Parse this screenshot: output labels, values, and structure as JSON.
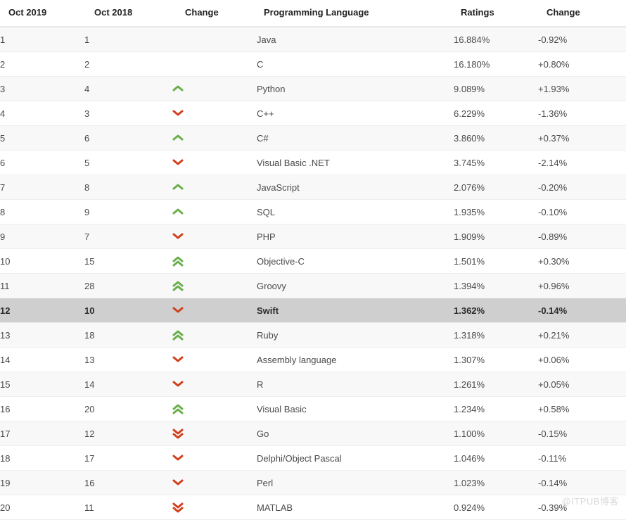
{
  "table": {
    "headers": {
      "rank_now": "Oct 2019",
      "rank_prev": "Oct 2018",
      "change_dir": "Change",
      "language": "Programming Language",
      "ratings": "Ratings",
      "change_val": "Change"
    },
    "rows": [
      {
        "rank_now": "1",
        "rank_prev": "1",
        "change_dir": "none",
        "language": "Java",
        "ratings": "16.884%",
        "change_val": "-0.92%",
        "highlight": false
      },
      {
        "rank_now": "2",
        "rank_prev": "2",
        "change_dir": "none",
        "language": "C",
        "ratings": "16.180%",
        "change_val": "+0.80%",
        "highlight": false
      },
      {
        "rank_now": "3",
        "rank_prev": "4",
        "change_dir": "up",
        "language": "Python",
        "ratings": "9.089%",
        "change_val": "+1.93%",
        "highlight": false
      },
      {
        "rank_now": "4",
        "rank_prev": "3",
        "change_dir": "down",
        "language": "C++",
        "ratings": "6.229%",
        "change_val": "-1.36%",
        "highlight": false
      },
      {
        "rank_now": "5",
        "rank_prev": "6",
        "change_dir": "up",
        "language": "C#",
        "ratings": "3.860%",
        "change_val": "+0.37%",
        "highlight": false
      },
      {
        "rank_now": "6",
        "rank_prev": "5",
        "change_dir": "down",
        "language": "Visual Basic .NET",
        "ratings": "3.745%",
        "change_val": "-2.14%",
        "highlight": false
      },
      {
        "rank_now": "7",
        "rank_prev": "8",
        "change_dir": "up",
        "language": "JavaScript",
        "ratings": "2.076%",
        "change_val": "-0.20%",
        "highlight": false
      },
      {
        "rank_now": "8",
        "rank_prev": "9",
        "change_dir": "up",
        "language": "SQL",
        "ratings": "1.935%",
        "change_val": "-0.10%",
        "highlight": false
      },
      {
        "rank_now": "9",
        "rank_prev": "7",
        "change_dir": "down",
        "language": "PHP",
        "ratings": "1.909%",
        "change_val": "-0.89%",
        "highlight": false
      },
      {
        "rank_now": "10",
        "rank_prev": "15",
        "change_dir": "up-double",
        "language": "Objective-C",
        "ratings": "1.501%",
        "change_val": "+0.30%",
        "highlight": false
      },
      {
        "rank_now": "11",
        "rank_prev": "28",
        "change_dir": "up-double",
        "language": "Groovy",
        "ratings": "1.394%",
        "change_val": "+0.96%",
        "highlight": false
      },
      {
        "rank_now": "12",
        "rank_prev": "10",
        "change_dir": "down",
        "language": "Swift",
        "ratings": "1.362%",
        "change_val": "-0.14%",
        "highlight": true
      },
      {
        "rank_now": "13",
        "rank_prev": "18",
        "change_dir": "up-double",
        "language": "Ruby",
        "ratings": "1.318%",
        "change_val": "+0.21%",
        "highlight": false
      },
      {
        "rank_now": "14",
        "rank_prev": "13",
        "change_dir": "down",
        "language": "Assembly language",
        "ratings": "1.307%",
        "change_val": "+0.06%",
        "highlight": false
      },
      {
        "rank_now": "15",
        "rank_prev": "14",
        "change_dir": "down",
        "language": "R",
        "ratings": "1.261%",
        "change_val": "+0.05%",
        "highlight": false
      },
      {
        "rank_now": "16",
        "rank_prev": "20",
        "change_dir": "up-double",
        "language": "Visual Basic",
        "ratings": "1.234%",
        "change_val": "+0.58%",
        "highlight": false
      },
      {
        "rank_now": "17",
        "rank_prev": "12",
        "change_dir": "down-double",
        "language": "Go",
        "ratings": "1.100%",
        "change_val": "-0.15%",
        "highlight": false
      },
      {
        "rank_now": "18",
        "rank_prev": "17",
        "change_dir": "down",
        "language": "Delphi/Object Pascal",
        "ratings": "1.046%",
        "change_val": "-0.11%",
        "highlight": false
      },
      {
        "rank_now": "19",
        "rank_prev": "16",
        "change_dir": "down",
        "language": "Perl",
        "ratings": "1.023%",
        "change_val": "-0.14%",
        "highlight": false
      },
      {
        "rank_now": "20",
        "rank_prev": "11",
        "change_dir": "down-double",
        "language": "MATLAB",
        "ratings": "0.924%",
        "change_val": "-0.39%",
        "highlight": false
      }
    ]
  },
  "watermark": {
    "text": "@ITPUB博客"
  },
  "colors": {
    "up": "#6aae4c",
    "down": "#d2401e",
    "highlight_row": "#cfcfcf",
    "stripe": "#f8f8f8"
  }
}
